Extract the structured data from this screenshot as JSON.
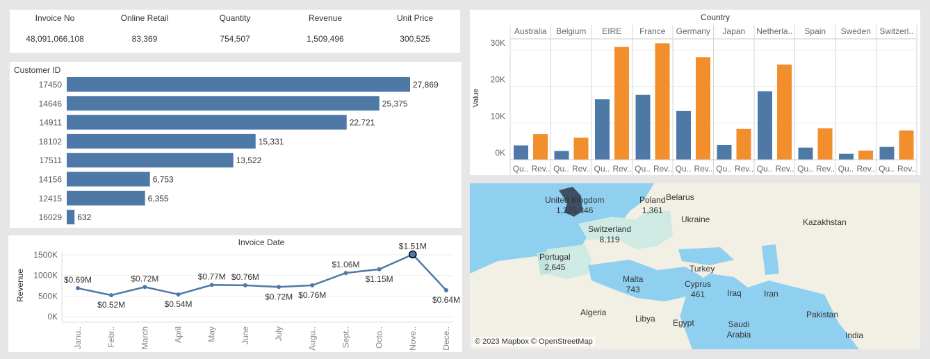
{
  "kpi": [
    {
      "label": "Invoice No",
      "value": "48,091,066,108"
    },
    {
      "label": "Online Retail",
      "value": "83,369"
    },
    {
      "label": "Quantity",
      "value": "754,507"
    },
    {
      "label": "Revenue",
      "value": "1,509,496"
    },
    {
      "label": "Unit Price",
      "value": "300,525"
    }
  ],
  "customer_chart": {
    "title": "Customer ID",
    "color": "#4e79a7"
  },
  "invoice_chart": {
    "title": "Invoice Date",
    "ylabel": "Revenue",
    "yticks": [
      "0K",
      "500K",
      "1000K",
      "1500K"
    ],
    "color": "#4e79a7"
  },
  "country_chart": {
    "title": "Country",
    "ylabel": "Value",
    "yticks": [
      "0K",
      "10K",
      "20K",
      "30K"
    ],
    "colors": {
      "Quantity": "#4e79a7",
      "Revenue": "#f28e2b"
    }
  },
  "map": {
    "credit": "© 2023 Mapbox © OpenStreetMap",
    "labels": [
      {
        "name": "United Kingdom",
        "value": "1,325,346"
      },
      {
        "name": "Poland",
        "value": "1,361"
      },
      {
        "name": "Switzerland",
        "value": "8,119"
      },
      {
        "name": "Portugal",
        "value": "2,645"
      },
      {
        "name": "Malta",
        "value": "743"
      },
      {
        "name": "Cyprus",
        "value": "461"
      }
    ],
    "countries": [
      "Belarus",
      "Ukraine",
      "Kazakhstan",
      "Turkey",
      "Iraq",
      "Iran",
      "Algeria",
      "Libya",
      "Egypt",
      "Saudi Arabia",
      "Pakistan",
      "India"
    ]
  },
  "chart_data": [
    {
      "type": "bar",
      "orientation": "horizontal",
      "title": "Customer ID",
      "categories": [
        "17450",
        "14646",
        "14911",
        "18102",
        "17511",
        "14156",
        "12415",
        "16029"
      ],
      "values": [
        27869,
        25375,
        22721,
        15331,
        13522,
        6753,
        6355,
        632
      ],
      "value_labels": [
        "27,869",
        "25,375",
        "22,721",
        "15,331",
        "13,522",
        "6,753",
        "6,355",
        "632"
      ]
    },
    {
      "type": "line",
      "title": "Invoice Date",
      "ylabel": "Revenue",
      "ylim": [
        0,
        1500000
      ],
      "x": [
        "Janu..",
        "Febr..",
        "March",
        "April",
        "May",
        "June",
        "July",
        "Augu..",
        "Sept..",
        "Octo..",
        "Nove..",
        "Dece.."
      ],
      "values": [
        690000,
        520000,
        720000,
        540000,
        770000,
        760000,
        720000,
        760000,
        1060000,
        1150000,
        1510000,
        640000
      ],
      "value_labels": [
        "$0.69M",
        "$0.52M",
        "$0.72M",
        "$0.54M",
        "$0.77M",
        "$0.76M",
        "$0.72M",
        "$0.76M",
        "$1.06M",
        "$1.15M",
        "$1.51M",
        "$0.64M"
      ]
    },
    {
      "type": "bar",
      "title": "Country",
      "ylabel": "Value",
      "ylim": [
        0,
        33000
      ],
      "categories": [
        "Australia",
        "Belgium",
        "EIRE",
        "France",
        "Germany",
        "Japan",
        "Netherla..",
        "Spain",
        "Sweden",
        "Switzerl.."
      ],
      "measure_labels": [
        "Qu..",
        "Rev.."
      ],
      "series": [
        {
          "name": "Quantity",
          "values": [
            3900,
            2400,
            16500,
            17700,
            13300,
            4000,
            18700,
            3300,
            1600,
            3500
          ]
        },
        {
          "name": "Revenue",
          "values": [
            7000,
            6000,
            30800,
            31800,
            28000,
            8400,
            26000,
            8600,
            2500,
            8000
          ]
        }
      ]
    }
  ]
}
